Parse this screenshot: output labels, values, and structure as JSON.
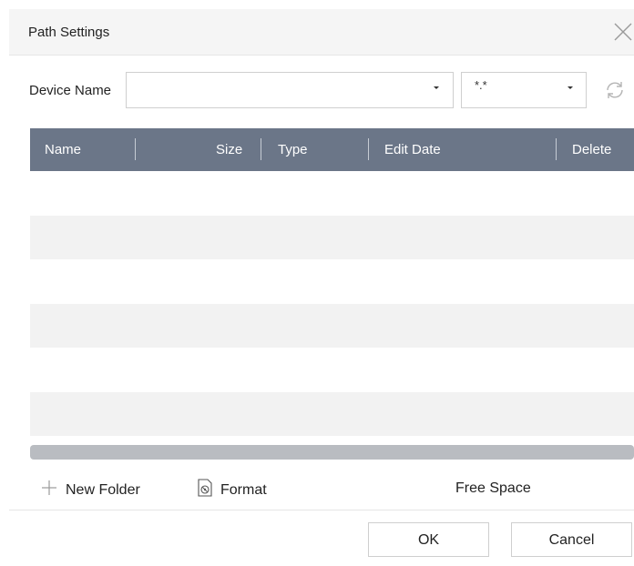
{
  "dialog": {
    "title": "Path Settings",
    "close_icon": "close-icon"
  },
  "device": {
    "label": "Device Name",
    "value": "",
    "dropdown_icon": "caret-down-icon"
  },
  "filter": {
    "value": "*.*",
    "dropdown_icon": "caret-down-icon"
  },
  "refresh_icon": "refresh-icon",
  "table": {
    "columns": [
      "Name",
      "Size",
      "Type",
      "Edit Date",
      "Delete"
    ],
    "rows": [],
    "header_color": "#6b7688",
    "alt_row_color": "#f2f2f2"
  },
  "toolbar": {
    "new_folder": "New Folder",
    "new_folder_icon": "plus-icon",
    "format": "Format",
    "format_icon": "format-disk-icon",
    "free_space_label": "Free Space"
  },
  "buttons": {
    "ok": "OK",
    "cancel": "Cancel"
  }
}
